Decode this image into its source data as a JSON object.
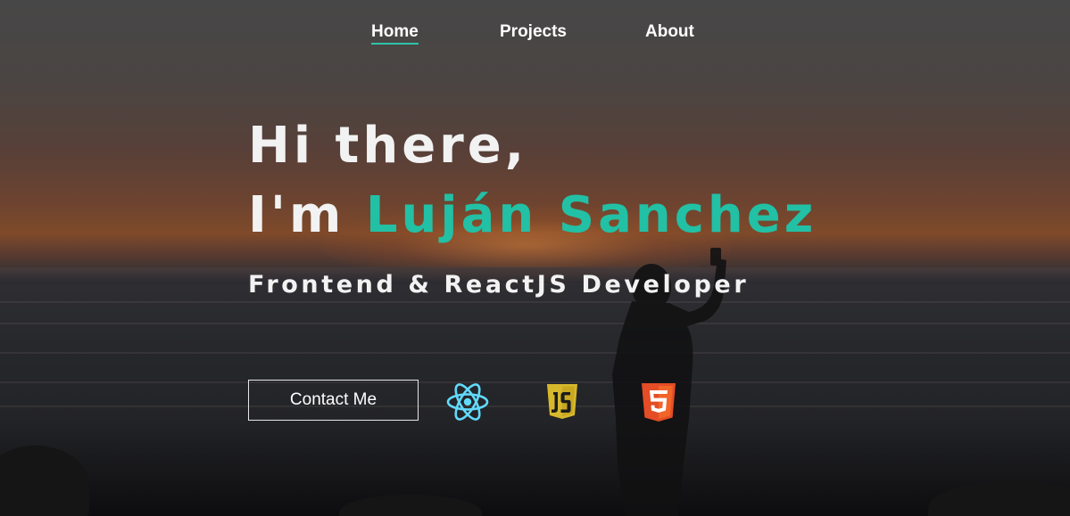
{
  "nav": {
    "items": [
      {
        "label": "Home",
        "active": true
      },
      {
        "label": "Projects",
        "active": false
      },
      {
        "label": "About",
        "active": false
      }
    ]
  },
  "hero": {
    "greeting_line1": "Hi there,",
    "greeting_line2_prefix": "I'm",
    "name": "Luján Sanchez",
    "role": "Frontend & ReactJS Developer"
  },
  "cta": {
    "contact_label": "Contact Me"
  },
  "tech_icons": [
    {
      "name": "react-icon",
      "color": "#61dafb"
    },
    {
      "name": "javascript-icon",
      "color": "#d6b82c"
    },
    {
      "name": "html5-icon",
      "color": "#e44d26"
    }
  ],
  "colors": {
    "accent": "#22c0a5",
    "text": "#f2f2f2"
  }
}
